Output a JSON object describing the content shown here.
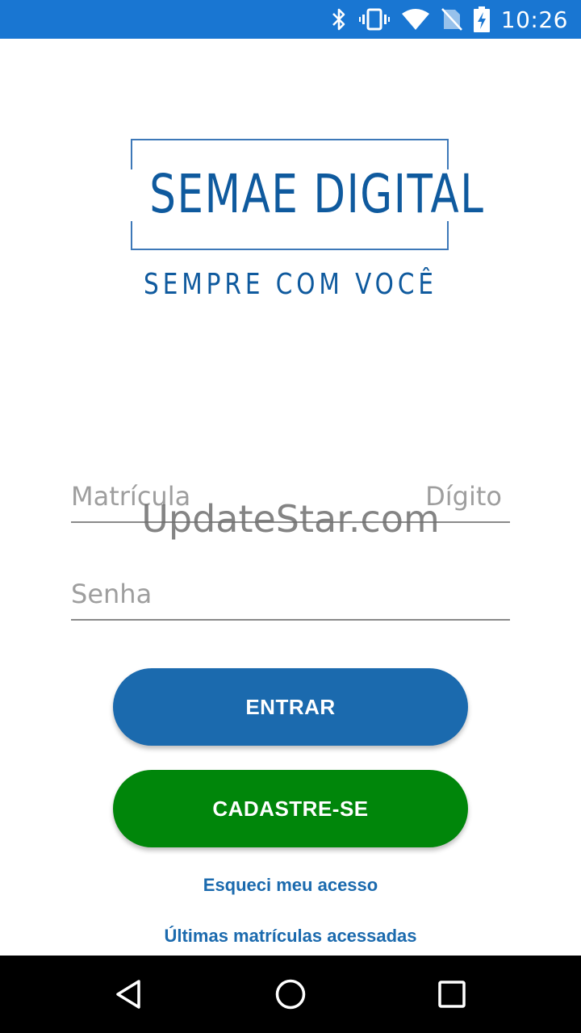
{
  "status_bar": {
    "time": "10:26",
    "icons": [
      "bluetooth-icon",
      "vibrate-icon",
      "wifi-icon",
      "no-sim-icon",
      "battery-charging-icon"
    ]
  },
  "logo": {
    "title": "SEMAE DIGITAL",
    "tagline": "SEMPRE COM VOCÊ"
  },
  "form": {
    "matricula_placeholder": "Matrícula",
    "digito_placeholder": "Dígito",
    "senha_placeholder": "Senha"
  },
  "watermark": "UpdateStar.com",
  "buttons": {
    "entrar": "ENTRAR",
    "cadastre": "CADASTRE-SE"
  },
  "links": {
    "esqueci": "Esqueci meu acesso",
    "ultimas": "Últimas matrículas acessadas"
  },
  "nav_bar": {
    "icons": [
      "back-icon",
      "home-icon",
      "recent-apps-icon"
    ]
  },
  "colors": {
    "status_bar": "#1976d2",
    "brand_blue": "#1b6aae",
    "brand_green": "#00860a"
  }
}
